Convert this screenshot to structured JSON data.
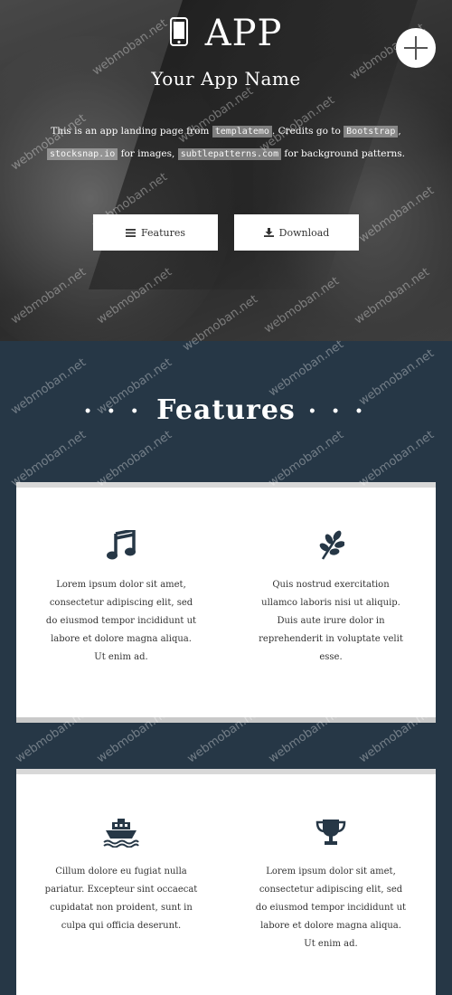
{
  "hero": {
    "title": "APP",
    "app_name": "Your App Name",
    "intro": {
      "t1": "This is an app landing page from ",
      "link1": "templatemo",
      "t2": ". Credits go to ",
      "link2": "Bootstrap",
      "t3": ", ",
      "link3": "stocksnap.io",
      "t4": " for images, ",
      "link4": "subtlepatterns.com",
      "t5": " for background patterns."
    },
    "buttons": {
      "features": "Features",
      "download": "Download"
    }
  },
  "features": {
    "heading": "Features",
    "dots": "• • •",
    "items": [
      {
        "icon": "music-icon",
        "text": "Lorem ipsum dolor sit amet, consectetur adipiscing elit, sed do eiusmod tempor incididunt ut labore et dolore magna aliqua. Ut enim ad."
      },
      {
        "icon": "leaf-icon",
        "text": "Quis nostrud exercitation ullamco laboris nisi ut aliquip. Duis aute irure dolor in reprehenderit in voluptate velit esse."
      },
      {
        "icon": "ship-icon",
        "text": "Cillum dolore eu fugiat nulla pariatur. Excepteur sint occaecat cupidatat non proident, sunt in culpa qui officia deserunt."
      },
      {
        "icon": "trophy-icon",
        "text": "Lorem ipsum dolor sit amet, consectetur adipiscing elit, sed do eiusmod tempor incididunt ut labore et dolore magna aliqua. Ut enim ad."
      }
    ]
  },
  "watermark": "webmoban.net",
  "colors": {
    "section_bg": "#263746",
    "icon": "#263746",
    "card_bg": "#ffffff"
  }
}
